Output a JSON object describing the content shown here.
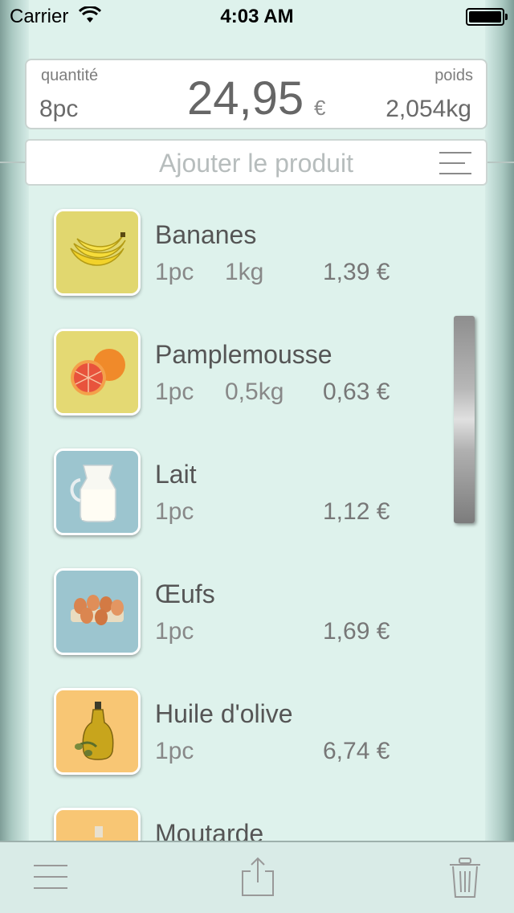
{
  "status": {
    "carrier": "Carrier",
    "time": "4:03 AM"
  },
  "summary": {
    "quantity_label": "quantité",
    "quantity_value": "8pc",
    "total": "24,95",
    "currency": "€",
    "weight_label": "poids",
    "weight_value": "2,054kg"
  },
  "add_field": {
    "placeholder": "Ajouter le produit"
  },
  "items": [
    {
      "name": "Bananes",
      "qty": "1pc",
      "weight": "1kg",
      "price": "1,39 €",
      "icon": "banana-icon",
      "color": "#e1d76f"
    },
    {
      "name": "Pamplemousse",
      "qty": "1pc",
      "weight": "0,5kg",
      "price": "0,63 €",
      "icon": "grapefruit-icon",
      "color": "#e4d973"
    },
    {
      "name": "Lait",
      "qty": "1pc",
      "weight": "",
      "price": "1,12 €",
      "icon": "milk-jug-icon",
      "color": "#9cc5cf"
    },
    {
      "name": "Œufs",
      "qty": "1pc",
      "weight": "",
      "price": "1,69 €",
      "icon": "eggs-icon",
      "color": "#9cc5cf"
    },
    {
      "name": "Huile d'olive",
      "qty": "1pc",
      "weight": "",
      "price": "6,74 €",
      "icon": "olive-oil-icon",
      "color": "#f8c674"
    },
    {
      "name": "Moutarde",
      "qty": "",
      "weight": "",
      "price": "",
      "icon": "mustard-icon",
      "color": "#f8c674"
    }
  ],
  "toolbar": {
    "menu": "menu-icon",
    "share": "share-icon",
    "trash": "trash-icon"
  }
}
